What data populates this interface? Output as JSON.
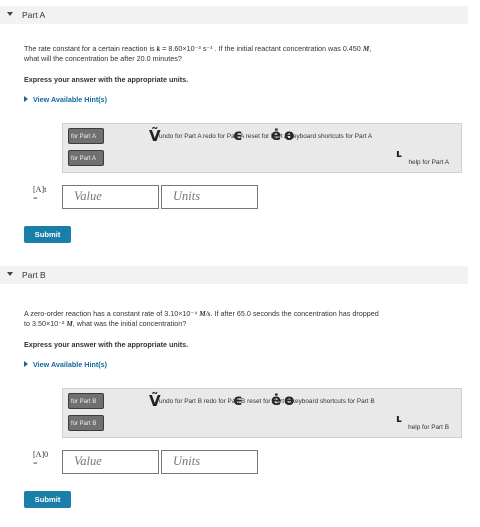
{
  "partA": {
    "title": "Part A",
    "question_pre": "The rate constant for a certain reaction is ",
    "question_k": "k",
    "question_value": " = 8.60×10⁻³ s⁻¹ . If the initial reactant concentration was 0.450 ",
    "question_unit": "M",
    "question_line2": "what will the concentration be after 20.0 minutes?",
    "express": "Express your answer with the appropriate units.",
    "hint": "View Available Hint(s)",
    "btn1": "for Part A",
    "btn2": "for Part A",
    "toolbar_text": "undo for Part A  redo for Part A  reset for Part A  keyboard shortcuts for Part A",
    "help": "help for Part A",
    "answer_label": "[A]t",
    "answer_eq": "=",
    "value_placeholder": "Value",
    "units_placeholder": "Units",
    "submit": "Submit"
  },
  "partB": {
    "title": "Part B",
    "question_pre": "A zero-order reaction has a constant rate of 3.10×10⁻⁴ ",
    "question_unit": "M/s",
    "question_post": ". If after 65.0 seconds the concentration has dropped",
    "question_line2_pre": "to 3.50×10⁻² ",
    "question_line2_unit": "M",
    "question_line2_post": ", what was the initial concentration?",
    "express": "Express your answer with the appropriate units.",
    "hint": "View Available Hint(s)",
    "btn1": "for Part B",
    "btn2": "for Part B",
    "toolbar_text": "undo for Part B  redo for Part B  reset for Part B  keyboard shortcuts for Part B",
    "help": "help for Part B",
    "answer_label": "[A]0",
    "answer_eq": "=",
    "value_placeholder": "Value",
    "units_placeholder": "Units",
    "submit": "Submit"
  },
  "icons": {
    "template_glyph": "Ṽ",
    "undo_glyph": "ϵ",
    "redo_glyph": "ė",
    "reset_glyph": "ɵ",
    "help_glyph": "ʟ"
  }
}
